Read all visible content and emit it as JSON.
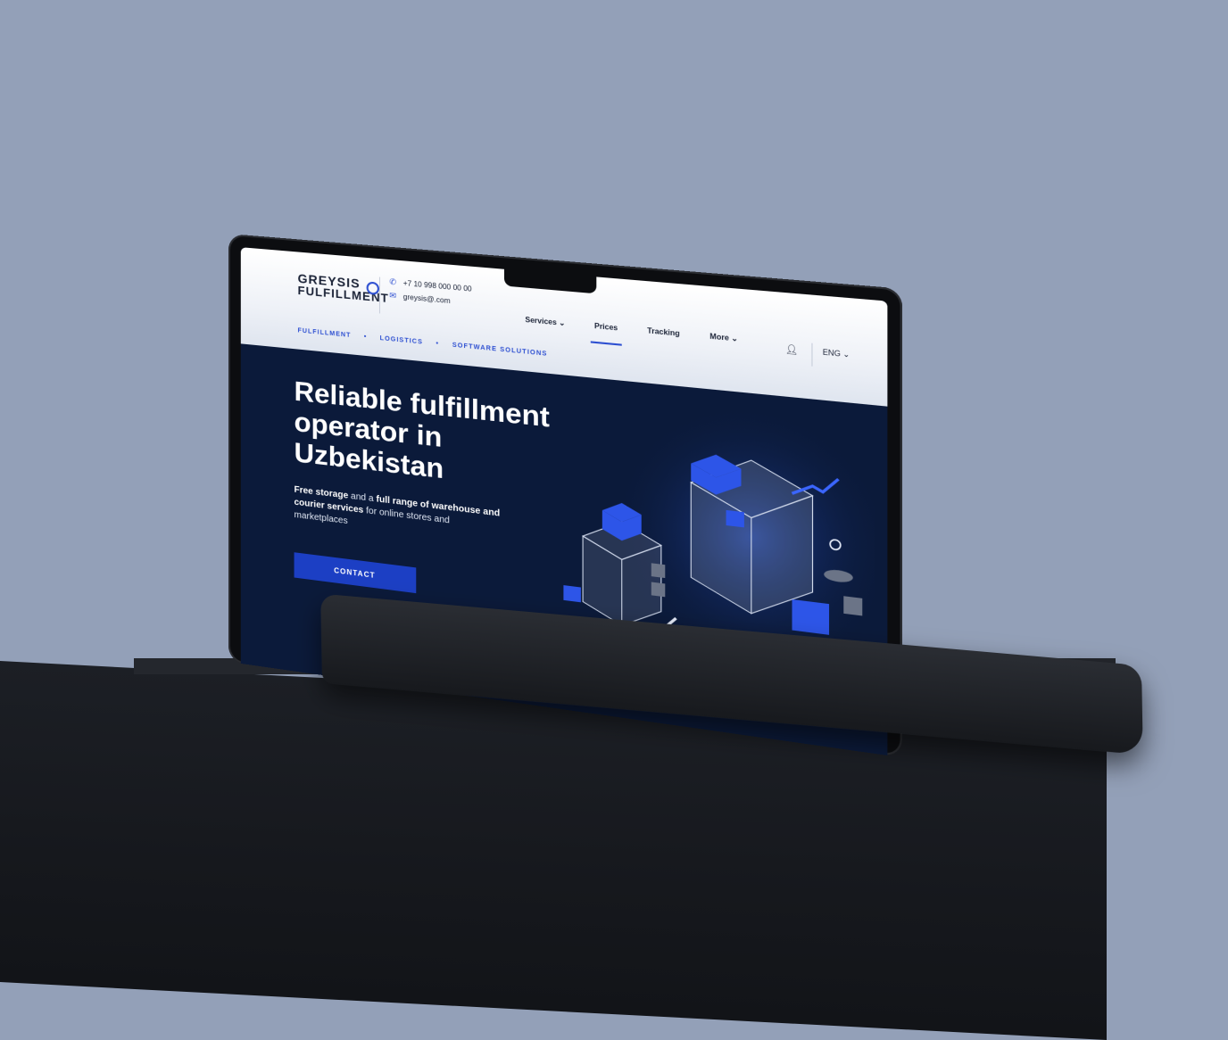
{
  "site": {
    "logo": {
      "line1": "GREYSIS",
      "line2": "FULFILLMENT"
    },
    "contact": {
      "phone": "+7 10 998 000 00 00",
      "email": "greysis@.com"
    },
    "nav": [
      {
        "label": "Services",
        "has_dropdown": true
      },
      {
        "label": "Prices",
        "active": true
      },
      {
        "label": "Tracking"
      },
      {
        "label": "More",
        "has_dropdown": true
      }
    ],
    "language": "ENG",
    "subnav": [
      "FULFILLMENT",
      "LOGISTICS",
      "SOFTWARE SOLUTIONS"
    ],
    "hero": {
      "title": "Reliable fulfillment operator in Uzbekistan",
      "subtitle_bold1": "Free storage",
      "subtitle_mid": " and a ",
      "subtitle_bold2": "full range of warehouse and courier services",
      "subtitle_end": " for online stores and marketplaces",
      "cta": "CONTACT"
    }
  },
  "colors": {
    "background": "#93a0b8",
    "hero_bg": "#0b1a3a",
    "accent": "#2d4fd1",
    "cta": "#1c3fc4"
  },
  "icons": [
    "phone-icon",
    "mail-icon",
    "chevron-down-icon",
    "user-icon"
  ]
}
